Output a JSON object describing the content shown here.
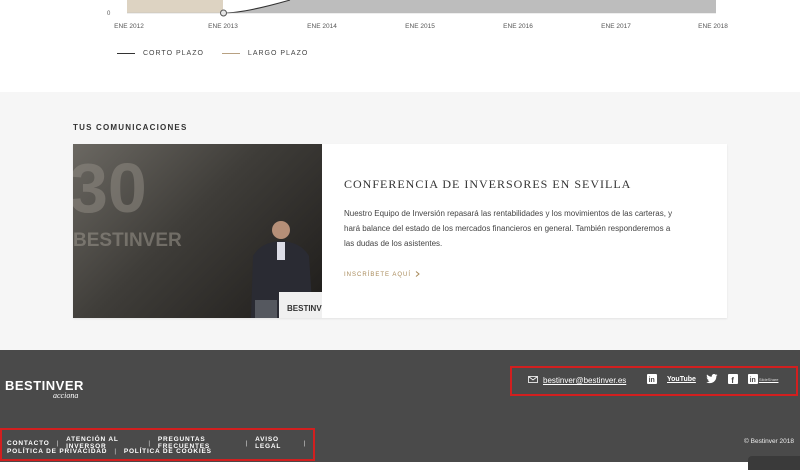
{
  "chart_data": {
    "type": "area",
    "y_zero_label": "0",
    "x_ticks": [
      "ENE 2012",
      "ENE 2013",
      "ENE 2014",
      "ENE 2015",
      "ENE 2016",
      "ENE 2017",
      "ENE 2018"
    ],
    "series": [
      {
        "name": "CORTO PLAZO",
        "color": "#333333"
      },
      {
        "name": "LARGO PLAZO",
        "color": "#b8a182"
      }
    ],
    "colors": {
      "fill_beige": "#ddd3c2",
      "fill_gray": "#bdbdbd"
    }
  },
  "communications": {
    "title": "TUS COMUNICACIONES",
    "card": {
      "photo_alt": "photo",
      "photo_overlay_number": "30",
      "photo_overlay_text1": "BESTINVER",
      "photo_podium_text": "BESTINVER",
      "heading": "CONFERENCIA DE INVERSORES EN SEVILLA",
      "text": "Nuestro Equipo de Inversión repasará las rentabilidades y los movimientos de las carteras, y hará balance del estado de los mercados financieros en general. También responderemos a las dudas de los asistentes.",
      "link": "INSCRÍBETE AQUÍ",
      "link_icon": "chevron-right-icon"
    }
  },
  "footer": {
    "logo_main": "BESTINVER",
    "logo_sub": "acciona",
    "email": "bestinver@bestinver.es",
    "email_icon": "mail-icon",
    "social": {
      "linkedin": "in",
      "youtube": "YouTube",
      "twitter_icon": "twitter-icon",
      "facebook": "f",
      "slideshare_in": "in",
      "slideshare": "SlideShare"
    },
    "nav_row1": [
      "CONTACTO",
      "ATENCIÓN AL INVERSOR",
      "PREGUNTAS FRECUENTES",
      "AVISO LEGAL"
    ],
    "nav_row2": [
      "POLÍTICA DE PRIVACIDAD",
      "POLÍTICA DE COOKIES"
    ],
    "copyright": "© Bestinver 2018",
    "accent_color": "#d21f1f"
  }
}
